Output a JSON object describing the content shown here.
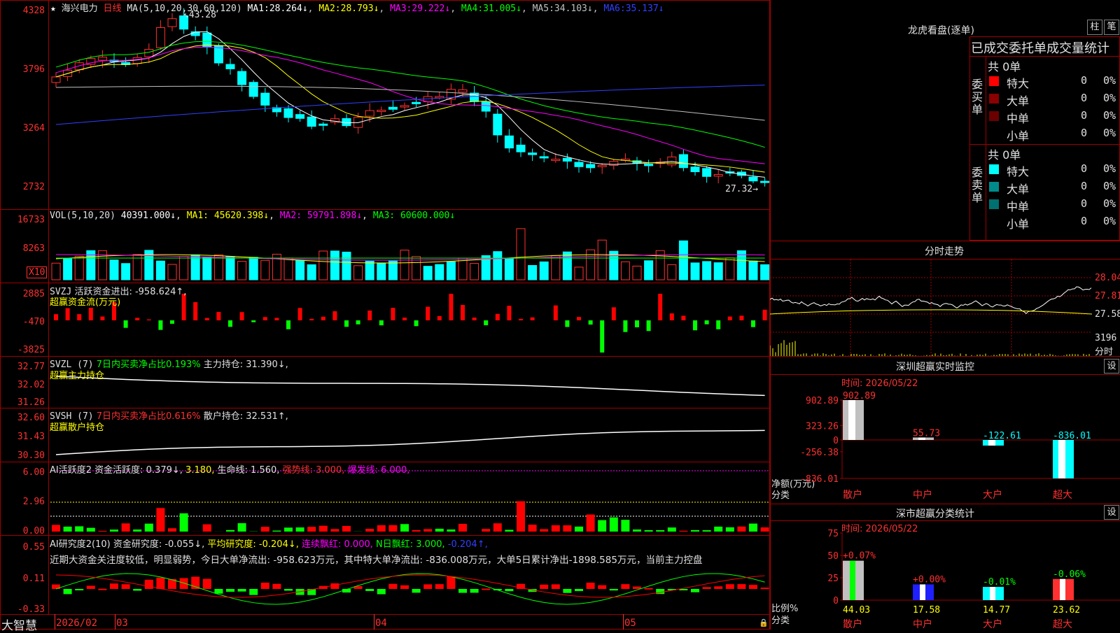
{
  "header": {
    "stock_name": "海兴电力",
    "period": "日线",
    "ma_params": "MA(5,10,20,30,60,120)",
    "ma_values": [
      {
        "label": "MA1:",
        "value": "28.264↓",
        "color": "#ffffff"
      },
      {
        "label": "MA2:",
        "value": "28.793↓",
        "color": "#ffff00"
      },
      {
        "label": "MA3:",
        "value": "29.222↓",
        "color": "#ff00ff"
      },
      {
        "label": "MA4:",
        "value": "31.005↓",
        "color": "#00ff00"
      },
      {
        "label": "MA5:",
        "value": "34.103↓",
        "color": "#c0c0c0"
      },
      {
        "label": "MA6:",
        "value": "35.137↓",
        "color": "#3040ff"
      }
    ],
    "high_mark": "43.28",
    "low_mark": "27.32"
  },
  "axis": {
    "price": [
      "4328",
      "3796",
      "3264",
      "2732"
    ],
    "vol": [
      "16733",
      "8263",
      "X10"
    ],
    "svzj": [
      "2885",
      "-470",
      "-3825"
    ],
    "svzl": [
      "32.77",
      "32.02",
      "31.26"
    ],
    "svsh": [
      "32.60",
      "31.43",
      "30.30"
    ],
    "ai1": [
      "6.00",
      "2.96",
      "0.00"
    ],
    "ai2": [
      "0.55",
      "0.11",
      "-0.33"
    ]
  },
  "panels": {
    "vol": {
      "name": "VOL(5,10,20)",
      "value": "40391.000↓",
      "ma1": "MA1: 45620.398↓",
      "ma2": "MA2: 59791.898↓",
      "ma3": "MA3: 60600.000↓"
    },
    "svzj": {
      "name": "SVZJ",
      "desc": "活跃资金进出: -958.624↑,",
      "sub": "超赢资金流(万元)"
    },
    "svzl": {
      "name": "SVZL (7)",
      "desc": "7日内买卖净占比0.193%",
      "hold": "主力持仓: 31.390↓,",
      "sub": "超赢主力持仓"
    },
    "svsh": {
      "name": "SVSH (7)",
      "desc": "7日内买卖净占比0.616%",
      "hold": "散户持仓: 32.531↑,",
      "sub": "超赢散户持仓"
    },
    "ai1": {
      "name": "AI活跃度2",
      "v1": "资金活跃度: 0.379↓,",
      "v2": "3.180,",
      "v3": "生命线: 1.560,",
      "v4": "强势线: 3.000,",
      "v5": "爆发线: 6.000,"
    },
    "ai2": {
      "name": "AI研究度2(10)",
      "v1": "资金研究度: -0.055↓,",
      "v2": "平均研究度: -0.204↓,",
      "v3": "连续飘红: 0.000,",
      "v4": "N日飘红: 3.000,",
      "v5": "-0.204↑,",
      "comment": "近期大资金关注度较低，明显弱势，今日大单净流出: -958.623万元，其中特大单净流出: -836.008万元，大单5日累计净出-1898.585万元，当前主力控盘"
    }
  },
  "bottom": {
    "brand": "大智慧",
    "dates": [
      "2026/02",
      "03",
      "04",
      "05"
    ]
  },
  "lhb": {
    "title": "龙虎看盘(逐单)",
    "btn1": "柱",
    "btn2": "笔",
    "tabs": "已成交委托单成交量统计",
    "buy_label": "委买单",
    "sell_label": "委卖单",
    "buy_total": "共 0单",
    "sell_total": "共 0单",
    "buy_rows": [
      {
        "name": "特大",
        "qty": "0",
        "pct": "0%",
        "color": "#ff0000"
      },
      {
        "name": "大单",
        "qty": "0",
        "pct": "0%",
        "color": "#8b0000"
      },
      {
        "name": "中单",
        "qty": "0",
        "pct": "0%",
        "color": "#6b0000"
      },
      {
        "name": "小单",
        "qty": "0",
        "pct": "0%",
        "color": ""
      }
    ],
    "sell_rows": [
      {
        "name": "特大",
        "qty": "0",
        "pct": "0%",
        "color": "#00ffff"
      },
      {
        "name": "大单",
        "qty": "0",
        "pct": "0%",
        "color": "#008b8b"
      },
      {
        "name": "中单",
        "qty": "0",
        "pct": "0%",
        "color": "#007070"
      },
      {
        "name": "小单",
        "qty": "0",
        "pct": "0%",
        "color": ""
      }
    ]
  },
  "intraday": {
    "title": "分时走势",
    "prices": [
      "28.04",
      "27.81",
      "27.58"
    ],
    "vol": "3196",
    "vol_unit": "分时"
  },
  "monitor": {
    "title": "深圳超赢实时监控",
    "btn": "设",
    "time": "时间: 2026/05/22",
    "axis": [
      "902.89",
      "323.26",
      "0",
      "-256.38",
      "-836.01"
    ],
    "unit1": "净额(万元)",
    "unit2": "分类",
    "bars": [
      {
        "cat": "散户",
        "val": "902.89",
        "num": 902.89
      },
      {
        "cat": "中户",
        "val": "55.73",
        "num": 55.73
      },
      {
        "cat": "大户",
        "val": "-122.61",
        "num": -122.61
      },
      {
        "cat": "超大",
        "val": "-836.01",
        "num": -836.01
      }
    ]
  },
  "classify": {
    "title": "深市超赢分类统计",
    "btn": "设",
    "time": "时间: 2026/05/22",
    "axis": [
      "75",
      "50",
      "25",
      "0"
    ],
    "unit1": "比例%",
    "unit2": "分类",
    "bars": [
      {
        "cat": "散户",
        "pct": "44.03",
        "num": 44.03,
        "delta": "+0.07%"
      },
      {
        "cat": "中户",
        "pct": "17.58",
        "num": 17.58,
        "delta": "+0.00%"
      },
      {
        "cat": "大户",
        "pct": "14.77",
        "num": 14.77,
        "delta": "-0.01%"
      },
      {
        "cat": "超大",
        "pct": "23.62",
        "num": 23.62,
        "delta": "-0.06%"
      }
    ]
  }
}
